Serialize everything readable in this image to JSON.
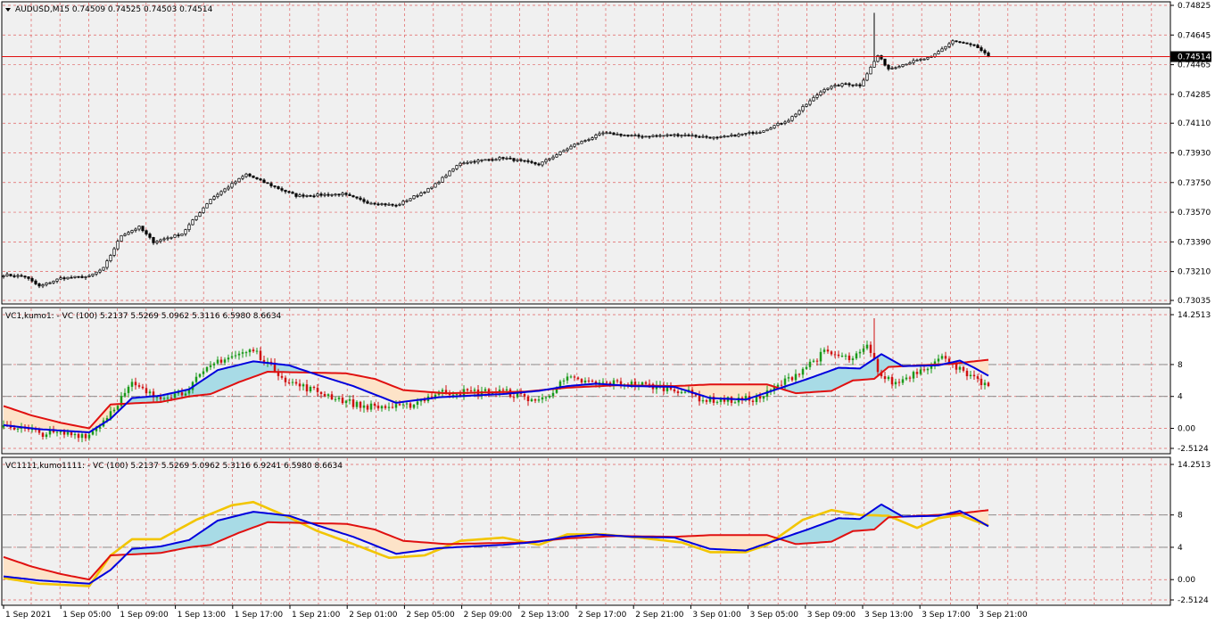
{
  "window": {
    "symbol_header": "AUDUSD,M15  0.74509 0.74525 0.74503 0.74514",
    "current_price_label": "0.74514"
  },
  "colors": {
    "background": "#ffffff",
    "plot_background": "#f0f0f0",
    "grid": "#e06060",
    "bull_candle": "#1a9a1a",
    "bear_candle": "#d01010",
    "price_candle": "#000000",
    "blue_line": "#0000dd",
    "red_line": "#e01010",
    "yellow_line": "#f2c500",
    "bull_cloud": "#a8dbe6",
    "bear_cloud": "#fde3c8",
    "level_line": "#808080"
  },
  "chart_data": [
    {
      "type": "candlestick",
      "name": "price",
      "header": "AUDUSD,M15  0.74509 0.74525 0.74503 0.74514",
      "y_ticks": [
        "0.74825",
        "0.74645",
        "0.74465",
        "0.74285",
        "0.74110",
        "0.73930",
        "0.73750",
        "0.73570",
        "0.73390",
        "0.73210",
        "0.73035"
      ],
      "ylim": [
        0.73035,
        0.74825
      ],
      "last_price": 0.74514,
      "close_anchors": [
        [
          0,
          0.7319
        ],
        [
          6,
          0.7318
        ],
        [
          10,
          0.7312
        ],
        [
          16,
          0.7317
        ],
        [
          24,
          0.7318
        ],
        [
          28,
          0.7323
        ],
        [
          33,
          0.7343
        ],
        [
          38,
          0.7348
        ],
        [
          42,
          0.7339
        ],
        [
          50,
          0.7344
        ],
        [
          58,
          0.7365
        ],
        [
          68,
          0.738
        ],
        [
          72,
          0.7376
        ],
        [
          82,
          0.7367
        ],
        [
          95,
          0.7368
        ],
        [
          102,
          0.7363
        ],
        [
          110,
          0.7361
        ],
        [
          120,
          0.7372
        ],
        [
          128,
          0.7387
        ],
        [
          140,
          0.739
        ],
        [
          150,
          0.7386
        ],
        [
          160,
          0.7398
        ],
        [
          168,
          0.7405
        ],
        [
          178,
          0.7403
        ],
        [
          190,
          0.7404
        ],
        [
          200,
          0.7402
        ],
        [
          206,
          0.7404
        ],
        [
          212,
          0.7406
        ],
        [
          220,
          0.7413
        ],
        [
          230,
          0.7432
        ],
        [
          236,
          0.7435
        ],
        [
          240,
          0.7434
        ],
        [
          245,
          0.7452
        ],
        [
          248,
          0.7444
        ],
        [
          254,
          0.7448
        ],
        [
          260,
          0.7451
        ],
        [
          266,
          0.7461
        ],
        [
          272,
          0.7458
        ],
        [
          276,
          0.74514
        ]
      ],
      "spike_high": 0.7478
    },
    {
      "type": "indicator",
      "name": "VC1,kumo1",
      "header": "VC1,kumo1: - VC (100) 5.2137 5.5269 5.0962 5.3116 6.5980 8.6634",
      "y_ticks": [
        "14.2513",
        "8",
        "4",
        "0.00",
        "-2.5124"
      ],
      "ylim": [
        -2.5124,
        14.2513
      ],
      "levels": [
        8,
        4
      ],
      "vc_anchors": [
        [
          0,
          0.5
        ],
        [
          10,
          -0.6
        ],
        [
          24,
          -0.8
        ],
        [
          28,
          1.0
        ],
        [
          36,
          5.5
        ],
        [
          42,
          4.0
        ],
        [
          50,
          4.4
        ],
        [
          60,
          8.5
        ],
        [
          70,
          9.8
        ],
        [
          80,
          5.8
        ],
        [
          88,
          4.6
        ],
        [
          100,
          2.8
        ],
        [
          112,
          2.6
        ],
        [
          122,
          4.5
        ],
        [
          140,
          4.6
        ],
        [
          150,
          3.4
        ],
        [
          158,
          6.2
        ],
        [
          166,
          5.6
        ],
        [
          172,
          5.7
        ],
        [
          180,
          5.4
        ],
        [
          190,
          4.8
        ],
        [
          196,
          3.6
        ],
        [
          205,
          3.5
        ],
        [
          212,
          3.8
        ],
        [
          222,
          6.8
        ],
        [
          230,
          9.5
        ],
        [
          238,
          8.6
        ],
        [
          242,
          10.2
        ],
        [
          246,
          6.5
        ],
        [
          250,
          5.6
        ],
        [
          256,
          7.2
        ],
        [
          264,
          9.0
        ],
        [
          270,
          6.5
        ],
        [
          276,
          5.3
        ]
      ],
      "blue_anchors": [
        [
          0,
          0.4
        ],
        [
          10,
          -0.1
        ],
        [
          24,
          -0.5
        ],
        [
          30,
          1.2
        ],
        [
          36,
          3.8
        ],
        [
          44,
          4.1
        ],
        [
          52,
          4.9
        ],
        [
          60,
          7.3
        ],
        [
          70,
          8.4
        ],
        [
          80,
          7.9
        ],
        [
          88,
          6.7
        ],
        [
          98,
          5.3
        ],
        [
          110,
          3.2
        ],
        [
          122,
          3.9
        ],
        [
          140,
          4.3
        ],
        [
          150,
          4.7
        ],
        [
          158,
          5.3
        ],
        [
          166,
          5.6
        ],
        [
          176,
          5.3
        ],
        [
          188,
          5.2
        ],
        [
          198,
          3.8
        ],
        [
          208,
          3.6
        ],
        [
          214,
          4.5
        ],
        [
          226,
          6.3
        ],
        [
          234,
          7.6
        ],
        [
          240,
          7.5
        ],
        [
          246,
          9.3
        ],
        [
          252,
          7.8
        ],
        [
          262,
          7.9
        ],
        [
          268,
          8.5
        ],
        [
          272,
          7.6
        ],
        [
          276,
          6.6
        ]
      ],
      "red_anchors": [
        [
          0,
          2.8
        ],
        [
          8,
          1.6
        ],
        [
          16,
          0.7
        ],
        [
          24,
          0.0
        ],
        [
          30,
          3.0
        ],
        [
          44,
          3.3
        ],
        [
          52,
          4.0
        ],
        [
          58,
          4.3
        ],
        [
          66,
          5.8
        ],
        [
          74,
          7.1
        ],
        [
          96,
          6.9
        ],
        [
          104,
          6.2
        ],
        [
          112,
          4.8
        ],
        [
          124,
          4.4
        ],
        [
          146,
          4.6
        ],
        [
          158,
          5.1
        ],
        [
          172,
          5.4
        ],
        [
          188,
          5.3
        ],
        [
          198,
          5.5
        ],
        [
          214,
          5.5
        ],
        [
          222,
          4.4
        ],
        [
          232,
          4.7
        ],
        [
          238,
          6.0
        ],
        [
          244,
          6.2
        ],
        [
          248,
          7.7
        ],
        [
          266,
          8.1
        ],
        [
          276,
          8.6
        ]
      ]
    },
    {
      "type": "indicator",
      "name": "VC1111,kumo1111",
      "header": "VC1111,kumo1111: - VC (100) 5.2137 5.5269 5.0962 5.3116 6.9241 6.5980 8.6634",
      "y_ticks": [
        "14.2513",
        "8",
        "4",
        "0.00",
        "-2.5124"
      ],
      "ylim": [
        -2.5124,
        14.2513
      ],
      "levels": [
        8,
        4
      ],
      "yellow_anchors": [
        [
          0,
          0.2
        ],
        [
          10,
          -0.5
        ],
        [
          24,
          -0.8
        ],
        [
          30,
          3.0
        ],
        [
          36,
          5.0
        ],
        [
          44,
          5.0
        ],
        [
          54,
          7.4
        ],
        [
          64,
          9.2
        ],
        [
          70,
          9.6
        ],
        [
          80,
          7.7
        ],
        [
          88,
          6.0
        ],
        [
          98,
          4.4
        ],
        [
          108,
          2.7
        ],
        [
          118,
          3.0
        ],
        [
          128,
          4.8
        ],
        [
          140,
          5.2
        ],
        [
          150,
          4.3
        ],
        [
          158,
          5.6
        ],
        [
          168,
          5.6
        ],
        [
          178,
          5.2
        ],
        [
          190,
          4.6
        ],
        [
          198,
          3.4
        ],
        [
          208,
          3.4
        ],
        [
          214,
          4.3
        ],
        [
          224,
          7.4
        ],
        [
          232,
          8.6
        ],
        [
          240,
          8.0
        ],
        [
          248,
          7.9
        ],
        [
          256,
          6.4
        ],
        [
          262,
          7.6
        ],
        [
          268,
          8.0
        ],
        [
          272,
          7.3
        ],
        [
          276,
          6.7
        ]
      ],
      "blue_anchors": [
        [
          0,
          0.4
        ],
        [
          10,
          -0.1
        ],
        [
          24,
          -0.5
        ],
        [
          30,
          1.2
        ],
        [
          36,
          3.8
        ],
        [
          44,
          4.1
        ],
        [
          52,
          4.9
        ],
        [
          60,
          7.3
        ],
        [
          70,
          8.4
        ],
        [
          80,
          7.9
        ],
        [
          88,
          6.7
        ],
        [
          98,
          5.3
        ],
        [
          110,
          3.2
        ],
        [
          122,
          3.9
        ],
        [
          140,
          4.3
        ],
        [
          150,
          4.7
        ],
        [
          158,
          5.3
        ],
        [
          166,
          5.6
        ],
        [
          176,
          5.3
        ],
        [
          188,
          5.2
        ],
        [
          198,
          3.8
        ],
        [
          208,
          3.6
        ],
        [
          214,
          4.5
        ],
        [
          226,
          6.3
        ],
        [
          234,
          7.6
        ],
        [
          240,
          7.5
        ],
        [
          246,
          9.3
        ],
        [
          252,
          7.8
        ],
        [
          262,
          7.9
        ],
        [
          268,
          8.5
        ],
        [
          272,
          7.6
        ],
        [
          276,
          6.6
        ]
      ],
      "red_anchors": [
        [
          0,
          2.8
        ],
        [
          8,
          1.6
        ],
        [
          16,
          0.7
        ],
        [
          24,
          0.0
        ],
        [
          30,
          3.0
        ],
        [
          44,
          3.3
        ],
        [
          52,
          4.0
        ],
        [
          58,
          4.3
        ],
        [
          66,
          5.8
        ],
        [
          74,
          7.1
        ],
        [
          96,
          6.9
        ],
        [
          104,
          6.2
        ],
        [
          112,
          4.8
        ],
        [
          124,
          4.4
        ],
        [
          146,
          4.6
        ],
        [
          158,
          5.1
        ],
        [
          172,
          5.4
        ],
        [
          188,
          5.3
        ],
        [
          198,
          5.5
        ],
        [
          214,
          5.5
        ],
        [
          222,
          4.4
        ],
        [
          232,
          4.7
        ],
        [
          238,
          6.0
        ],
        [
          244,
          6.2
        ],
        [
          248,
          7.7
        ],
        [
          266,
          8.1
        ],
        [
          276,
          8.6
        ]
      ]
    }
  ],
  "x_axis": {
    "bars": 277,
    "labels": [
      "1 Sep 2021",
      "1 Sep 05:00",
      "1 Sep 09:00",
      "1 Sep 13:00",
      "1 Sep 17:00",
      "1 Sep 21:00",
      "2 Sep 01:00",
      "2 Sep 05:00",
      "2 Sep 09:00",
      "2 Sep 13:00",
      "2 Sep 17:00",
      "2 Sep 21:00",
      "3 Sep 01:00",
      "3 Sep 05:00",
      "3 Sep 09:00",
      "3 Sep 13:00",
      "3 Sep 17:00",
      "3 Sep 21:00"
    ]
  }
}
